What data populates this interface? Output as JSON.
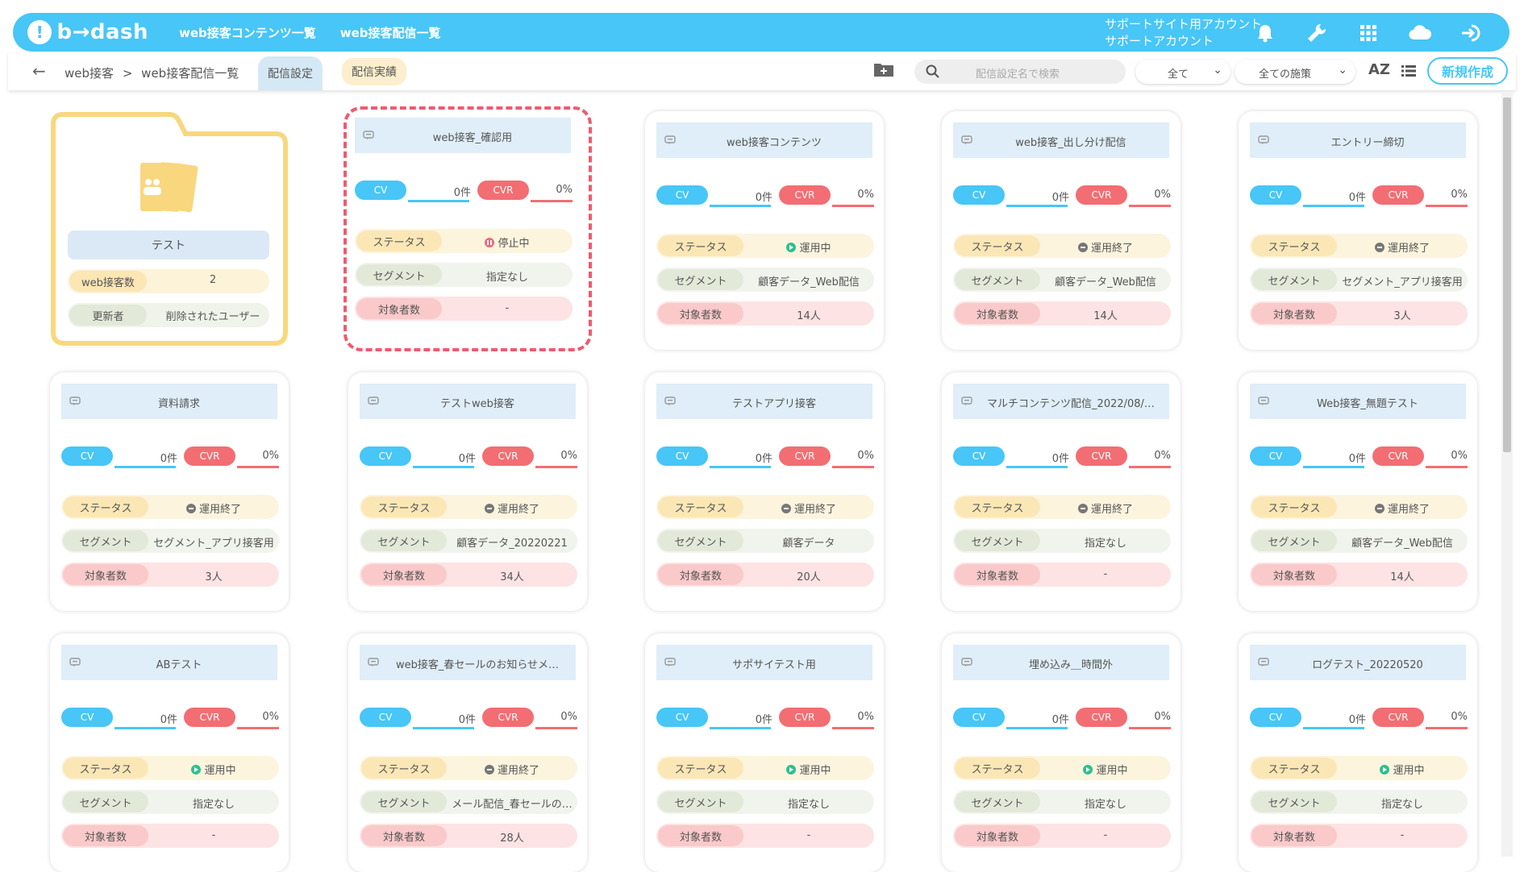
{
  "header": {
    "logo_text": "b→dash",
    "nav": [
      "web接客コンテンツ一覧",
      "web接客配信一覧"
    ],
    "account_line1": "サポートサイト用アカウント",
    "account_line2": "サポートアカウント",
    "icons": [
      "bell-icon",
      "wrench-icon",
      "grid-icon",
      "cloud-icon",
      "logout-icon"
    ]
  },
  "subbar": {
    "breadcrumb_root": "web接客",
    "breadcrumb_sep": ">",
    "breadcrumb_current": "web接客配信一覧",
    "tab_settings": "配信設定",
    "tab_results": "配信実績",
    "search_placeholder": "配信設定名で検索",
    "filter1": "全て",
    "filter2": "全ての施策",
    "sort_label": "AZ",
    "create_button": "新規作成"
  },
  "folder": {
    "name": "テスト",
    "row1_label": "web接客数",
    "row1_value": "2",
    "row2_label": "更新者",
    "row2_value": "削除されたユーザー"
  },
  "labels": {
    "cv": "CV",
    "cvr": "CVR",
    "status": "ステータス",
    "segment": "セグメント",
    "target": "対象者数"
  },
  "colors": {
    "accent": "#47c6f7",
    "cvr": "#f26e73",
    "selected_border": "#ef5a6f",
    "folder": "#f8d77e"
  },
  "cards": [
    {
      "title": "web接客_確認用",
      "cv": "0件",
      "cvr": "0%",
      "status": "停止中",
      "status_type": "paused",
      "segment": "指定なし",
      "target": "-",
      "selected": true
    },
    {
      "title": "web接客コンテンツ",
      "cv": "0件",
      "cvr": "0%",
      "status": "運用中",
      "status_type": "running",
      "segment": "顧客データ_Web配信",
      "target": "14人"
    },
    {
      "title": "web接客_出し分け配信",
      "cv": "0件",
      "cvr": "0%",
      "status": "運用終了",
      "status_type": "ended",
      "segment": "顧客データ_Web配信",
      "target": "14人"
    },
    {
      "title": "エントリー締切",
      "cv": "0件",
      "cvr": "0%",
      "status": "運用終了",
      "status_type": "ended",
      "segment": "セグメント_アプリ接客用",
      "target": "3人"
    },
    {
      "title": "資料請求",
      "cv": "0件",
      "cvr": "0%",
      "status": "運用終了",
      "status_type": "ended",
      "segment": "セグメント_アプリ接客用",
      "target": "3人"
    },
    {
      "title": "テストweb接客",
      "cv": "0件",
      "cvr": "0%",
      "status": "運用終了",
      "status_type": "ended",
      "segment": "顧客データ_20220221",
      "target": "34人"
    },
    {
      "title": "テストアプリ接客",
      "cv": "0件",
      "cvr": "0%",
      "status": "運用終了",
      "status_type": "ended",
      "segment": "顧客データ",
      "target": "20人"
    },
    {
      "title": "マルチコンテンツ配信_2022/08/…",
      "cv": "0件",
      "cvr": "0%",
      "status": "運用終了",
      "status_type": "ended",
      "segment": "指定なし",
      "target": "-"
    },
    {
      "title": "Web接客_無題テスト",
      "cv": "0件",
      "cvr": "0%",
      "status": "運用終了",
      "status_type": "ended",
      "segment": "顧客データ_Web配信",
      "target": "14人"
    },
    {
      "title": "ABテスト",
      "cv": "0件",
      "cvr": "0%",
      "status": "運用中",
      "status_type": "running",
      "segment": "指定なし",
      "target": "-"
    },
    {
      "title": "web接客_春セールのお知らせメ…",
      "cv": "0件",
      "cvr": "0%",
      "status": "運用終了",
      "status_type": "ended",
      "segment": "メール配信_春セールの…",
      "target": "28人"
    },
    {
      "title": "サポサイテスト用",
      "cv": "0件",
      "cvr": "0%",
      "status": "運用中",
      "status_type": "running",
      "segment": "指定なし",
      "target": "-"
    },
    {
      "title": "埋め込み＿時間外",
      "cv": "0件",
      "cvr": "0%",
      "status": "運用中",
      "status_type": "running",
      "segment": "指定なし",
      "target": "-"
    },
    {
      "title": "ログテスト_20220520",
      "cv": "0件",
      "cvr": "0%",
      "status": "運用中",
      "status_type": "running",
      "segment": "指定なし",
      "target": "-"
    }
  ]
}
